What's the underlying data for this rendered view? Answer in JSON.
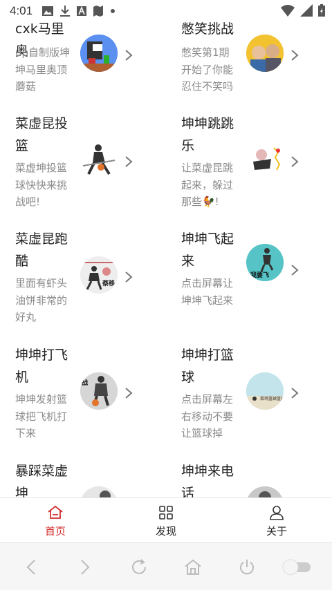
{
  "status_bar": {
    "time": "4:01"
  },
  "cards": [
    {
      "title": "cxk马里奥",
      "desc": "up自制版坤坤马里奥顶蘑菇"
    },
    {
      "title": "憋笑挑战",
      "desc": "憋笑第1期开始了你能忍住不笑吗"
    },
    {
      "title": "菜虚昆投篮",
      "desc": "菜虚坤投篮球快快来挑战吧!"
    },
    {
      "title": "坤坤跳跳乐",
      "desc": "让菜虚昆跳起来，躲过那些🐓!"
    },
    {
      "title": "菜虚昆跑酷",
      "desc": "里面有虾头油饼非常的好丸"
    },
    {
      "title": "坤坤飞起来",
      "desc": "点击屏幕让坤坤飞起来"
    },
    {
      "title": "坤坤打飞机",
      "desc": "坤坤发射篮球把飞机打下来"
    },
    {
      "title": "坤坤打篮球",
      "desc": "点击屏幕左右移动不要让篮球掉"
    },
    {
      "title": "暴踩菜虚坤",
      "desc": ""
    },
    {
      "title": "坤坤来电话",
      "desc": ""
    }
  ],
  "thumb_text": {
    "parkour": "蔡移",
    "fly": "我要飞",
    "plane": "战",
    "basket": "菜鸡篮球篮球"
  },
  "tabs": [
    {
      "label": "首页",
      "icon": "home-icon",
      "active": true
    },
    {
      "label": "发现",
      "icon": "grid-icon",
      "active": false
    },
    {
      "label": "关于",
      "icon": "person-icon",
      "active": false
    }
  ],
  "accent_color": "#d32f2f",
  "browser_nav": [
    "back-icon",
    "forward-icon",
    "refresh-icon",
    "home-icon",
    "power-icon",
    "toggle-switch"
  ]
}
